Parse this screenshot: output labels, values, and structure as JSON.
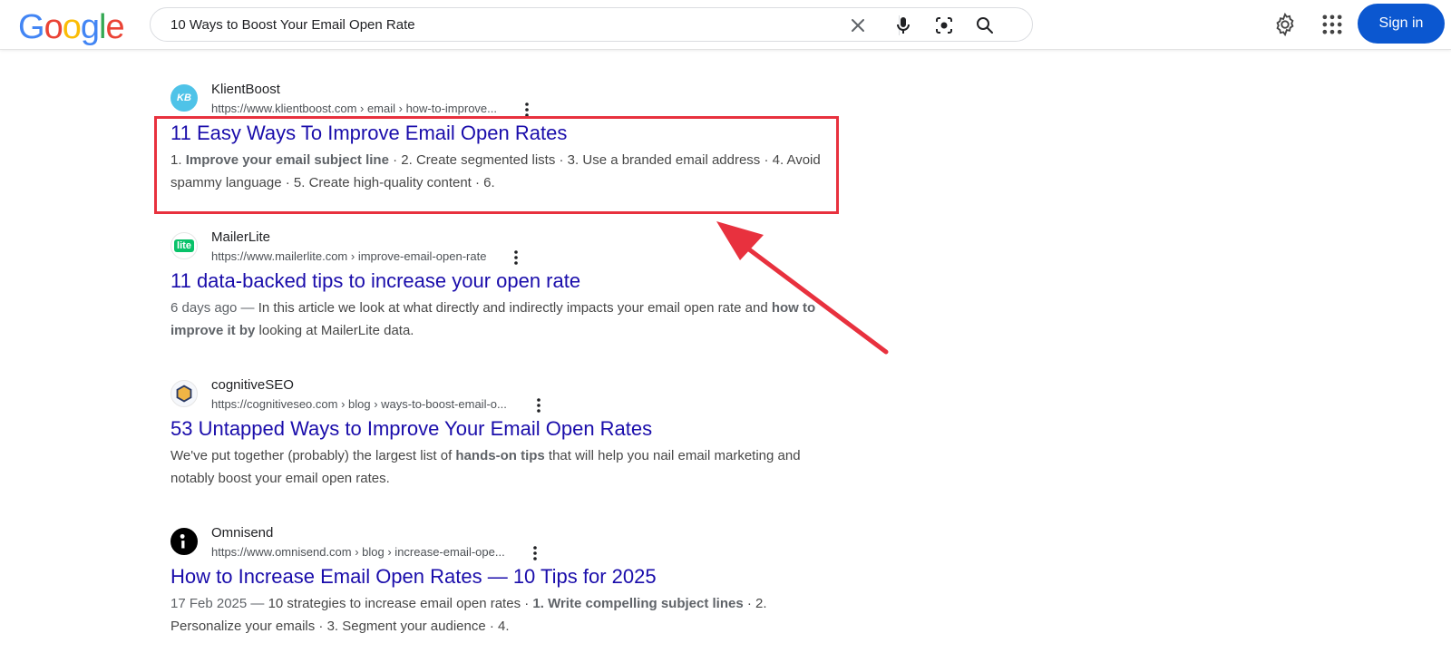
{
  "header": {
    "logo_letters": [
      {
        "char": "G",
        "color": "#4285F4"
      },
      {
        "char": "o",
        "color": "#EA4335"
      },
      {
        "char": "o",
        "color": "#FBBC05"
      },
      {
        "char": "g",
        "color": "#4285F4"
      },
      {
        "char": "l",
        "color": "#34A853"
      },
      {
        "char": "e",
        "color": "#EA4335"
      }
    ],
    "search_query": "10 Ways to Boost Your Email Open Rate",
    "sign_in_label": "Sign in",
    "accent_color": "#0b57d0"
  },
  "results": [
    {
      "site_name": "KlientBoost",
      "url": "https://www.klientboost.com › email › how-to-improve...",
      "title": "11 Easy Ways To Improve Email Open Rates",
      "snippet_parts": [
        {
          "text": "1. ",
          "bold": false
        },
        {
          "text": "Improve your email subject line",
          "bold": true
        },
        {
          "text": " · 2. Create segmented lists · 3. Use a branded email address · 4. Avoid spammy language · 5. Create high-quality content · 6.",
          "bold": false
        }
      ],
      "favicon_text": "KB",
      "favicon_color": "#4fc3e8",
      "highlighted": true
    },
    {
      "site_name": "MailerLite",
      "url": "https://www.mailerlite.com › improve-email-open-rate",
      "title": "11 data-backed tips to increase your open rate",
      "snippet_parts": [
        {
          "text": "6 days ago — ",
          "bold": false,
          "muted": true
        },
        {
          "text": "In this article we look at what directly and indirectly impacts your email open rate and ",
          "bold": false
        },
        {
          "text": "how to improve it by",
          "bold": true
        },
        {
          "text": " looking at MailerLite data.",
          "bold": false
        }
      ],
      "favicon_text": "lite",
      "favicon_color": "#09c269"
    },
    {
      "site_name": "cognitiveSEO",
      "url": "https://cognitiveseo.com › blog › ways-to-boost-email-o...",
      "title": "53 Untapped Ways to Improve Your Email Open Rates",
      "snippet_parts": [
        {
          "text": "We've put together (probably) the largest list of ",
          "bold": false
        },
        {
          "text": "hands-on tips",
          "bold": true
        },
        {
          "text": " that will help you nail email marketing and notably boost your email open rates.",
          "bold": false
        }
      ],
      "favicon_text": "",
      "favicon_color": "#e8a33d"
    },
    {
      "site_name": "Omnisend",
      "url": "https://www.omnisend.com › blog › increase-email-ope...",
      "title": "How to Increase Email Open Rates — 10 Tips for 2025",
      "snippet_parts": [
        {
          "text": "17 Feb 2025 — ",
          "bold": false,
          "muted": true
        },
        {
          "text": "10 strategies to increase email open rates · ",
          "bold": false
        },
        {
          "text": "1. Write compelling subject lines",
          "bold": true
        },
        {
          "text": " · 2. Personalize your emails · 3. Segment your audience · 4.",
          "bold": false
        }
      ],
      "favicon_text": "i",
      "favicon_color": "#000000"
    }
  ],
  "annotation": {
    "highlight_color": "#e8313e"
  }
}
